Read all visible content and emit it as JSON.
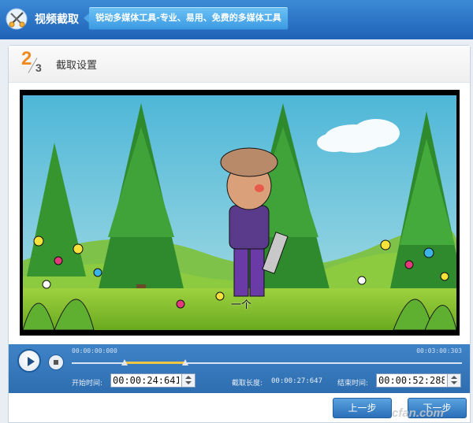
{
  "app": {
    "title": "视频截取",
    "slogan": "锐动多媒体工具-专业、易用、免费的多媒体工具",
    "icon": "scissors-icon"
  },
  "step": {
    "current": "2",
    "total": "3",
    "title": "截取设置"
  },
  "video": {
    "subtitle": "一个"
  },
  "timeline": {
    "start_time": "00:00:00:000",
    "end_time": "00:03:00:303",
    "selection_start_fraction": 0.136,
    "selection_end_fraction": 0.29
  },
  "trim": {
    "start_label": "开始时间:",
    "start_value": "00:00:24:641",
    "duration_label": "截取长度:",
    "duration_value": "00:00:27:647",
    "end_label": "结束时间:",
    "end_value": "00:00:52:288"
  },
  "buttons": {
    "prev_label": "上一步",
    "next_label": "下一步"
  },
  "watermark": "cfan.com",
  "colors": {
    "titlebar": "#2f74c4",
    "step_accent": "#f08a1c",
    "control_bar": "#3a7bc0"
  }
}
